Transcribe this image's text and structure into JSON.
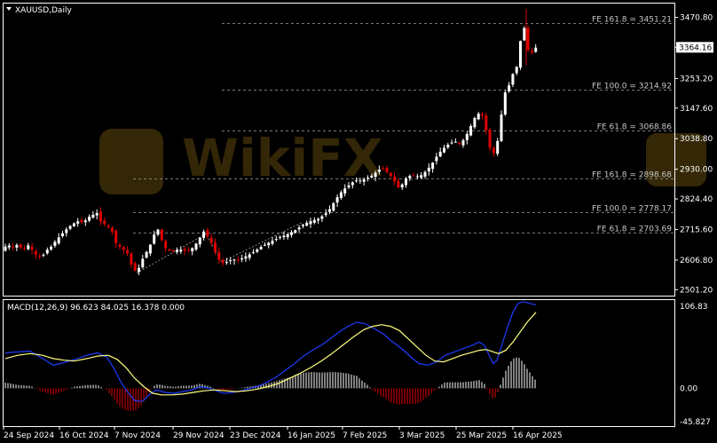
{
  "header": {
    "symbol_label": "XAUUSD,Daily",
    "macd_label": "MACD(12,26,9) 96.623 84.025 16.378 0.000"
  },
  "watermark": {
    "text": "WikiFX",
    "color": "#3a2c08"
  },
  "colors": {
    "background": "#000000",
    "frame": "#ffffff",
    "bull_candle": "#ffffff",
    "bear_candle": "#e00000",
    "fib_line": "#a0a0a0",
    "macd_line": "#1e3cff",
    "signal_line": "#ffff80",
    "hist_pos": "#ffffff",
    "hist_neg": "#e00000"
  },
  "chart_data": [
    {
      "type": "candlestick",
      "title": "XAUUSD,Daily",
      "ylim": [
        2480,
        3520
      ],
      "y_ticks": [
        "3470.80",
        "3364.16",
        "3253.20",
        "3147.60",
        "3038.80",
        "2930.00",
        "2824.40",
        "2715.60",
        "2606.80",
        "2501.20"
      ],
      "current_price_label": "3364.16",
      "x_tick_labels": [
        "24 Sep 2024",
        "16 Oct 2024",
        "7 Nov 2024",
        "29 Nov 2024",
        "23 Dec 2024",
        "16 Jan 2025",
        "7 Feb 2025",
        "3 Mar 2025",
        "25 Mar 2025",
        "16 Apr 2025"
      ],
      "fib_levels": [
        {
          "label": "FE 161.8 = 3451.21",
          "value": 3451.21
        },
        {
          "label": "FE 100.0 = 3214.92",
          "value": 3214.92
        },
        {
          "label": "FE 61.8 = 3068.86",
          "value": 3068.86
        },
        {
          "label": "FE 161.8 = 2898.68",
          "value": 2898.68
        },
        {
          "label": "FE 100.0 = 2778.17",
          "value": 2778.17
        },
        {
          "label": "FE 61.8 = 2703.69",
          "value": 2703.69
        }
      ],
      "close_path": [
        [
          0,
          2640
        ],
        [
          6,
          2655
        ],
        [
          12,
          2660
        ],
        [
          16,
          2648
        ],
        [
          20,
          2665
        ],
        [
          26,
          2640
        ],
        [
          32,
          2660
        ],
        [
          38,
          2635
        ],
        [
          42,
          2620
        ],
        [
          48,
          2620
        ],
        [
          52,
          2640
        ],
        [
          58,
          2655
        ],
        [
          64,
          2680
        ],
        [
          70,
          2700
        ],
        [
          76,
          2720
        ],
        [
          82,
          2735
        ],
        [
          88,
          2745
        ],
        [
          94,
          2740
        ],
        [
          100,
          2760
        ],
        [
          106,
          2770
        ],
        [
          110,
          2775
        ],
        [
          114,
          2740
        ],
        [
          118,
          2735
        ],
        [
          124,
          2720
        ],
        [
          128,
          2700
        ],
        [
          132,
          2650
        ],
        [
          136,
          2655
        ],
        [
          140,
          2640
        ],
        [
          144,
          2630
        ],
        [
          148,
          2590
        ],
        [
          152,
          2570
        ],
        [
          154,
          2560
        ],
        [
          158,
          2590
        ],
        [
          162,
          2620
        ],
        [
          166,
          2640
        ],
        [
          170,
          2665
        ],
        [
          174,
          2700
        ],
        [
          178,
          2715
        ],
        [
          182,
          2680
        ],
        [
          186,
          2650
        ],
        [
          190,
          2640
        ],
        [
          196,
          2640
        ],
        [
          202,
          2645
        ],
        [
          208,
          2640
        ],
        [
          214,
          2640
        ],
        [
          220,
          2660
        ],
        [
          226,
          2690
        ],
        [
          230,
          2710
        ],
        [
          234,
          2690
        ],
        [
          238,
          2670
        ],
        [
          242,
          2640
        ],
        [
          246,
          2610
        ],
        [
          250,
          2595
        ],
        [
          256,
          2600
        ],
        [
          262,
          2610
        ],
        [
          268,
          2605
        ],
        [
          274,
          2615
        ],
        [
          280,
          2625
        ],
        [
          286,
          2635
        ],
        [
          292,
          2650
        ],
        [
          298,
          2660
        ],
        [
          304,
          2670
        ],
        [
          310,
          2680
        ],
        [
          316,
          2690
        ],
        [
          322,
          2695
        ],
        [
          328,
          2705
        ],
        [
          334,
          2715
        ],
        [
          340,
          2730
        ],
        [
          346,
          2740
        ],
        [
          352,
          2748
        ],
        [
          358,
          2752
        ],
        [
          364,
          2765
        ],
        [
          370,
          2780
        ],
        [
          376,
          2810
        ],
        [
          382,
          2840
        ],
        [
          388,
          2860
        ],
        [
          394,
          2875
        ],
        [
          400,
          2890
        ],
        [
          406,
          2890
        ],
        [
          412,
          2895
        ],
        [
          418,
          2905
        ],
        [
          424,
          2920
        ],
        [
          430,
          2935
        ],
        [
          436,
          2920
        ],
        [
          442,
          2900
        ],
        [
          446,
          2880
        ],
        [
          450,
          2860
        ],
        [
          454,
          2880
        ],
        [
          458,
          2900
        ],
        [
          464,
          2910
        ],
        [
          470,
          2905
        ],
        [
          476,
          2910
        ],
        [
          482,
          2930
        ],
        [
          488,
          2955
        ],
        [
          494,
          2985
        ],
        [
          500,
          3005
        ],
        [
          506,
          3020
        ],
        [
          512,
          3030
        ],
        [
          518,
          3020
        ],
        [
          524,
          3040
        ],
        [
          530,
          3080
        ],
        [
          536,
          3120
        ],
        [
          542,
          3135
        ],
        [
          546,
          3100
        ],
        [
          550,
          3030
        ],
        [
          554,
          2985
        ],
        [
          558,
          2990
        ],
        [
          562,
          3050
        ],
        [
          566,
          3150
        ],
        [
          570,
          3215
        ],
        [
          574,
          3230
        ],
        [
          578,
          3270
        ],
        [
          582,
          3290
        ],
        [
          586,
          3380
        ],
        [
          590,
          3430
        ],
        [
          593,
          3440
        ],
        [
          596,
          3320
        ],
        [
          600,
          3350
        ],
        [
          604,
          3364
        ]
      ]
    },
    {
      "type": "macd",
      "title": "MACD(12,26,9) 96.623 84.025 16.378 0.000",
      "ylim": [
        -45.827,
        106.83
      ],
      "y_ticks": [
        "106.83",
        "0.00",
        "-45.827"
      ],
      "macd_line": [
        [
          6,
          43
        ],
        [
          20,
          44
        ],
        [
          34,
          45
        ],
        [
          48,
          36
        ],
        [
          60,
          28
        ],
        [
          72,
          31
        ],
        [
          84,
          35
        ],
        [
          98,
          40
        ],
        [
          110,
          43
        ],
        [
          120,
          38
        ],
        [
          128,
          25
        ],
        [
          136,
          8
        ],
        [
          144,
          -5
        ],
        [
          152,
          -15
        ],
        [
          160,
          -16
        ],
        [
          168,
          -8
        ],
        [
          176,
          -2
        ],
        [
          186,
          -5
        ],
        [
          196,
          -6
        ],
        [
          206,
          -4
        ],
        [
          216,
          -2
        ],
        [
          226,
          2
        ],
        [
          236,
          0
        ],
        [
          244,
          -3
        ],
        [
          252,
          -6
        ],
        [
          262,
          -5
        ],
        [
          272,
          -3
        ],
        [
          282,
          0
        ],
        [
          292,
          3
        ],
        [
          302,
          8
        ],
        [
          312,
          14
        ],
        [
          322,
          22
        ],
        [
          332,
          30
        ],
        [
          342,
          39
        ],
        [
          352,
          46
        ],
        [
          362,
          52
        ],
        [
          372,
          60
        ],
        [
          382,
          68
        ],
        [
          392,
          75
        ],
        [
          402,
          80
        ],
        [
          412,
          78
        ],
        [
          422,
          72
        ],
        [
          432,
          66
        ],
        [
          440,
          58
        ],
        [
          448,
          52
        ],
        [
          456,
          45
        ],
        [
          464,
          37
        ],
        [
          472,
          30
        ],
        [
          482,
          28
        ],
        [
          492,
          32
        ],
        [
          502,
          40
        ],
        [
          512,
          44
        ],
        [
          522,
          48
        ],
        [
          532,
          52
        ],
        [
          540,
          56
        ],
        [
          546,
          52
        ],
        [
          552,
          38
        ],
        [
          556,
          30
        ],
        [
          560,
          34
        ],
        [
          566,
          54
        ],
        [
          572,
          74
        ],
        [
          578,
          92
        ],
        [
          584,
          103
        ],
        [
          590,
          105
        ],
        [
          596,
          103
        ],
        [
          604,
          101
        ]
      ],
      "signal_line": [
        [
          6,
          36
        ],
        [
          20,
          40
        ],
        [
          34,
          42
        ],
        [
          48,
          40
        ],
        [
          60,
          36
        ],
        [
          72,
          34
        ],
        [
          84,
          33
        ],
        [
          98,
          36
        ],
        [
          110,
          39
        ],
        [
          122,
          40
        ],
        [
          132,
          35
        ],
        [
          142,
          25
        ],
        [
          152,
          12
        ],
        [
          162,
          2
        ],
        [
          172,
          -6
        ],
        [
          182,
          -8
        ],
        [
          194,
          -8
        ],
        [
          206,
          -7
        ],
        [
          218,
          -5
        ],
        [
          230,
          -3
        ],
        [
          242,
          -2
        ],
        [
          254,
          -3
        ],
        [
          266,
          -4
        ],
        [
          278,
          -3
        ],
        [
          290,
          -1
        ],
        [
          302,
          2
        ],
        [
          314,
          6
        ],
        [
          326,
          12
        ],
        [
          338,
          18
        ],
        [
          350,
          25
        ],
        [
          362,
          33
        ],
        [
          374,
          42
        ],
        [
          386,
          52
        ],
        [
          398,
          62
        ],
        [
          410,
          71
        ],
        [
          420,
          75
        ],
        [
          430,
          77
        ],
        [
          440,
          75
        ],
        [
          450,
          70
        ],
        [
          460,
          60
        ],
        [
          470,
          50
        ],
        [
          480,
          40
        ],
        [
          490,
          33
        ],
        [
          500,
          32
        ],
        [
          510,
          36
        ],
        [
          520,
          40
        ],
        [
          530,
          43
        ],
        [
          540,
          46
        ],
        [
          548,
          47
        ],
        [
          556,
          44
        ],
        [
          562,
          42
        ],
        [
          570,
          46
        ],
        [
          578,
          56
        ],
        [
          586,
          68
        ],
        [
          594,
          80
        ],
        [
          604,
          92
        ]
      ]
    }
  ]
}
